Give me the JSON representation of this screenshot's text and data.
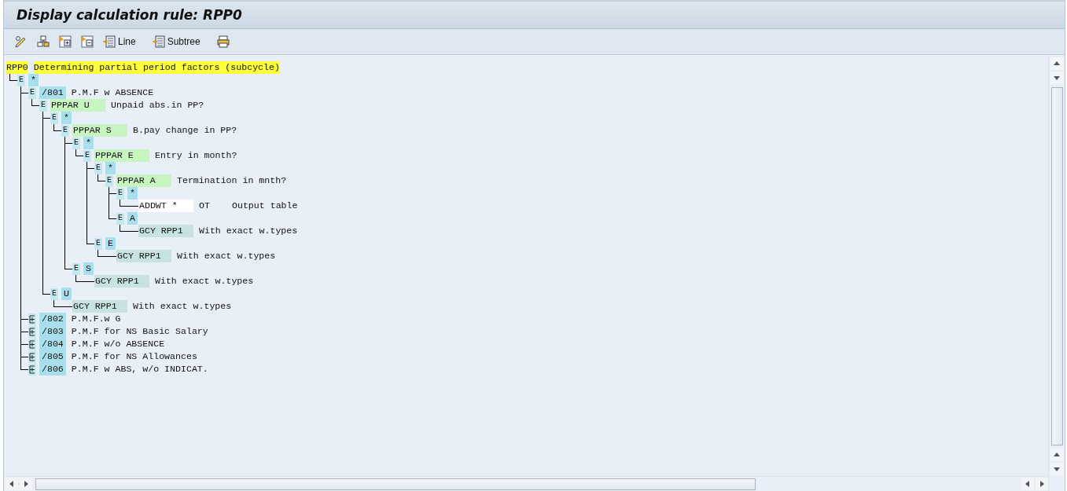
{
  "window": {
    "title": "Display calculation rule: RPP0"
  },
  "toolbar": [
    {
      "kind": "icon"
    },
    {
      "kind": "icon"
    },
    {
      "kind": "icon"
    },
    {
      "kind": "icon"
    },
    {
      "kind": "labeled",
      "label": "Line"
    },
    {
      "kind": "labeled",
      "label": "Subtree"
    },
    {
      "kind": "icon"
    }
  ],
  "tree": {
    "kind": "root",
    "code": "RPP0",
    "text": "Determining partial period factors (subcycle)",
    "children": [
      {
        "kind": "branch",
        "marker": "E",
        "expanded": true,
        "value": "*",
        "children": [
          {
            "kind": "branch",
            "marker": "E",
            "expanded": true,
            "value": "/801",
            "text": "P.M.F w ABSENCE",
            "children": [
              {
                "kind": "condition",
                "marker": "E",
                "expanded": true,
                "code": "PPPAR U",
                "text": "Unpaid abs.in PP?",
                "children": [
                  {
                    "kind": "branch",
                    "marker": "E",
                    "expanded": true,
                    "value": "*",
                    "children": [
                      {
                        "kind": "condition",
                        "marker": "E",
                        "expanded": true,
                        "code": "PPPAR S",
                        "text": "B.pay change in PP?",
                        "children": [
                          {
                            "kind": "branch",
                            "marker": "E",
                            "expanded": true,
                            "value": "*",
                            "children": [
                              {
                                "kind": "condition",
                                "marker": "E",
                                "expanded": true,
                                "code": "PPPAR E",
                                "text": "Entry in month?",
                                "children": [
                                  {
                                    "kind": "branch",
                                    "marker": "E",
                                    "expanded": true,
                                    "value": "*",
                                    "children": [
                                      {
                                        "kind": "condition",
                                        "marker": "E",
                                        "expanded": true,
                                        "code": "PPPAR A",
                                        "text": "Termination in mnth?",
                                        "children": [
                                          {
                                            "kind": "branch",
                                            "marker": "E",
                                            "expanded": true,
                                            "value": "*",
                                            "children": [
                                              {
                                                "kind": "output",
                                                "code": "ADDWT *",
                                                "column_3": "OT",
                                                "text": "Output table"
                                              }
                                            ]
                                          },
                                          {
                                            "kind": "branch",
                                            "marker": "E",
                                            "expanded": true,
                                            "value": "A",
                                            "children": [
                                              {
                                                "kind": "operation",
                                                "code": "GCY RPP1",
                                                "text": "With exact w.types"
                                              }
                                            ]
                                          }
                                        ]
                                      }
                                    ]
                                  },
                                  {
                                    "kind": "branch",
                                    "marker": "E",
                                    "expanded": true,
                                    "value": "E",
                                    "children": [
                                      {
                                        "kind": "operation",
                                        "code": "GCY RPP1",
                                        "text": "With exact w.types"
                                      }
                                    ]
                                  }
                                ]
                              }
                            ]
                          },
                          {
                            "kind": "branch",
                            "marker": "E",
                            "expanded": true,
                            "value": "S",
                            "children": [
                              {
                                "kind": "operation",
                                "code": "GCY RPP1",
                                "text": "With exact w.types"
                              }
                            ]
                          }
                        ]
                      }
                    ]
                  },
                  {
                    "kind": "branch",
                    "marker": "E",
                    "expanded": true,
                    "value": "U",
                    "children": [
                      {
                        "kind": "operation",
                        "code": "GCY RPP1",
                        "text": "With exact w.types"
                      }
                    ]
                  }
                ]
              }
            ]
          },
          {
            "kind": "branch",
            "expanded": false,
            "value": "/802",
            "text": "P.M.F.w G"
          },
          {
            "kind": "branch",
            "expanded": false,
            "value": "/803",
            "text": "P.M.F for NS Basic Salary"
          },
          {
            "kind": "branch",
            "expanded": false,
            "value": "/804",
            "text": "P.M.F w/o ABSENCE"
          },
          {
            "kind": "branch",
            "expanded": false,
            "value": "/805",
            "text": "P.M.F for NS Allowances"
          },
          {
            "kind": "branch",
            "expanded": false,
            "value": "/806",
            "text": "P.M.F w ABS, w/o INDICAT."
          }
        ]
      }
    ]
  }
}
